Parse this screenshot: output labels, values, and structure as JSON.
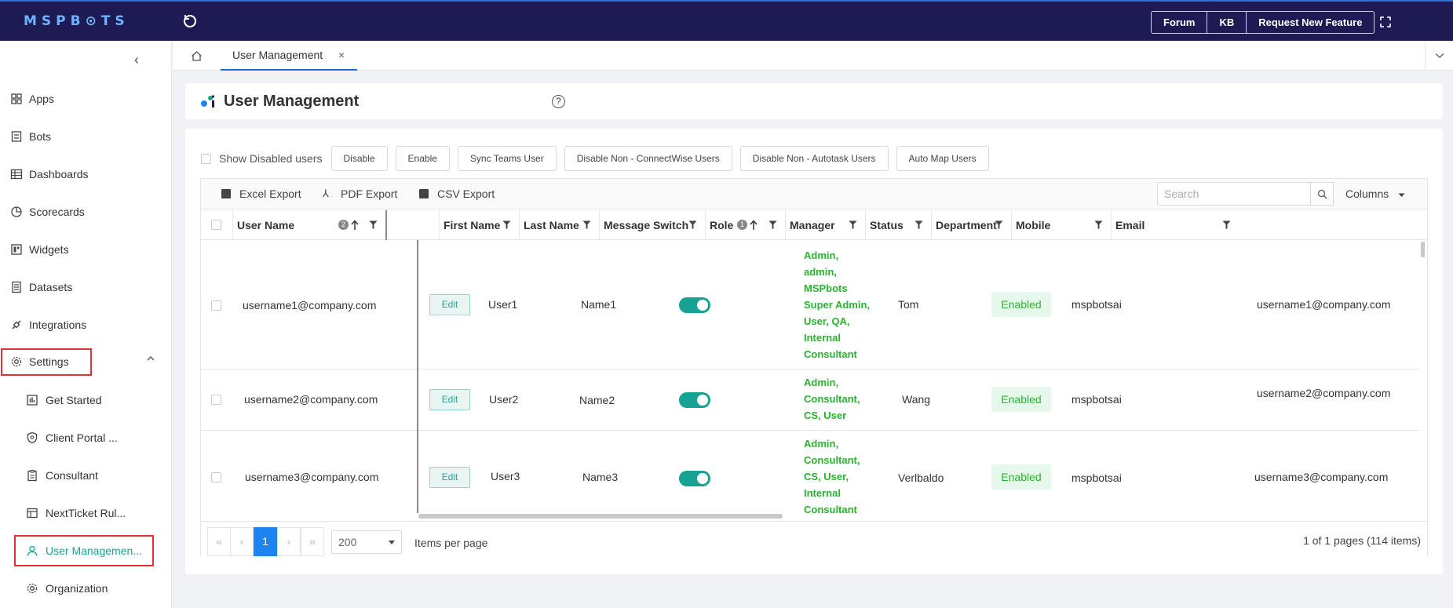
{
  "app": {
    "logo_text": "MSPB⊙TS",
    "top_buttons": [
      "Forum",
      "KB",
      "Request New Feature"
    ]
  },
  "sidebar": {
    "items": [
      {
        "label": "Apps",
        "icon": "apps-icon"
      },
      {
        "label": "Bots",
        "icon": "bot-icon"
      },
      {
        "label": "Dashboards",
        "icon": "dashboard-icon"
      },
      {
        "label": "Scorecards",
        "icon": "scorecard-icon"
      },
      {
        "label": "Widgets",
        "icon": "widget-icon"
      },
      {
        "label": "Datasets",
        "icon": "dataset-icon"
      },
      {
        "label": "Integrations",
        "icon": "integration-icon"
      },
      {
        "label": "Settings",
        "icon": "gear-icon"
      }
    ],
    "settings_children": [
      {
        "label": "Get Started",
        "icon": "chart-icon"
      },
      {
        "label": "Client Portal ...",
        "icon": "shield-icon"
      },
      {
        "label": "Consultant",
        "icon": "clipboard-icon"
      },
      {
        "label": "NextTicket Rul...",
        "icon": "ticket-icon"
      },
      {
        "label": "User Managemen...",
        "icon": "user-icon"
      },
      {
        "label": "Organization",
        "icon": "gear-icon"
      }
    ]
  },
  "tabs": {
    "active_label": "User Management",
    "close": "×"
  },
  "header": {
    "title": "User Management",
    "help": "?"
  },
  "toolbar": {
    "show_disabled": "Show Disabled users",
    "buttons": [
      "Disable",
      "Enable",
      "Sync Teams User",
      "Disable Non - ConnectWise Users",
      "Disable Non - Autotask Users",
      "Auto Map Users"
    ]
  },
  "grid": {
    "exports": [
      "Excel Export",
      "PDF Export",
      "CSV Export"
    ],
    "search_placeholder": "Search",
    "columns_label": "Columns",
    "headers": {
      "username": "User Name",
      "username_sort": "2",
      "firstname": "First Name",
      "lastname": "Last Name",
      "message": "Message Switch",
      "role": "Role",
      "role_sort": "1",
      "manager": "Manager",
      "status": "Status",
      "department": "Department",
      "mobile": "Mobile",
      "email": "Email"
    },
    "edit_label": "Edit",
    "rows": [
      {
        "username": "username1@company.com",
        "first": "User1",
        "last": "Name1",
        "role": [
          "Admin,",
          "admin,",
          "MSPbots",
          "Super Admin,",
          "User, QA,",
          "Internal",
          "Consultant"
        ],
        "manager": "Tom",
        "status": "Enabled",
        "department": "mspbotsai",
        "mobile": "",
        "email": "username1@company.com",
        "message_on": true
      },
      {
        "username": "username2@company.com",
        "first": "User2",
        "last": "Name2",
        "role": [
          "Admin,",
          "Consultant,",
          "CS, User"
        ],
        "manager": "Wang",
        "status": "Enabled",
        "department": "mspbotsai",
        "mobile": "",
        "email": "username2@company.com",
        "message_on": true
      },
      {
        "username": "username3@company.com",
        "first": "User3",
        "last": "Name3",
        "role": [
          "Admin,",
          "Consultant,",
          "CS, User,",
          "Internal",
          "Consultant"
        ],
        "manager": "Verlbaldo",
        "status": "Enabled",
        "department": "mspbotsai",
        "mobile": "",
        "email": "username3@company.com",
        "message_on": true
      }
    ]
  },
  "pager": {
    "first": "«",
    "prev": "‹",
    "current": "1",
    "next": "›",
    "last": "»",
    "page_size": "200",
    "items_per_page": "Items per page",
    "info": "1 of 1 pages (114 items)"
  }
}
